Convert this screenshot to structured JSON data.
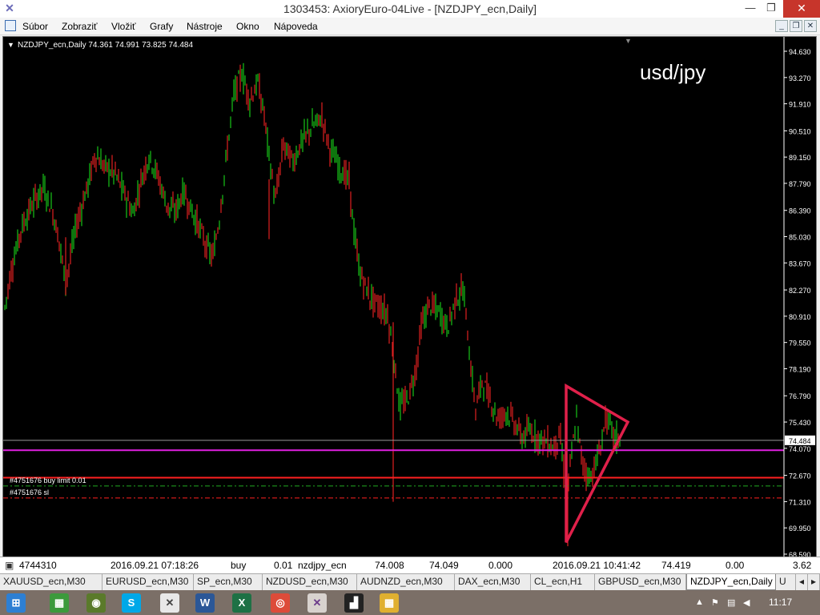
{
  "window": {
    "title": "1303453: AxioryEuro-04Live - [NZDJPY_ecn,Daily]",
    "minimize": "—",
    "maximize": "❐",
    "close": "✕"
  },
  "menu": [
    "Súbor",
    "Zobraziť",
    "Vložiť",
    "Grafy",
    "Nástroje",
    "Okno",
    "Nápoveda"
  ],
  "mdi": {
    "minimize": "_",
    "restore": "❐",
    "close": "✕"
  },
  "chart": {
    "header": "NZDJPY_ecn,Daily  74.361 74.991 73.825 74.484",
    "watermark": "usd/jpy",
    "current_price": "74.484",
    "orders": [
      "#4751676 buy limit 0.01",
      "#4751676 sl"
    ]
  },
  "chart_data": {
    "type": "candlestick",
    "symbol": "NZDJPY_ecn",
    "timeframe": "Daily",
    "ohlc_last": {
      "open": 74.361,
      "high": 74.991,
      "low": 73.825,
      "close": 74.484
    },
    "y_ticks": [
      "94.630",
      "93.270",
      "91.910",
      "90.510",
      "89.150",
      "87.790",
      "86.390",
      "85.030",
      "83.670",
      "82.270",
      "80.910",
      "79.550",
      "78.190",
      "76.790",
      "75.430",
      "74.070",
      "72.670",
      "71.310",
      "69.950",
      "68.590"
    ],
    "ylim": [
      68.59,
      94.63
    ],
    "bid_line": 74.484,
    "horizontal_lines": [
      {
        "price": 73.97,
        "color": "#e020e0",
        "style": "solid"
      },
      {
        "price": 72.55,
        "color": "#ff2020",
        "style": "solid"
      },
      {
        "price": 72.12,
        "color": "#22aa22",
        "style": "dashdot"
      },
      {
        "price": 71.5,
        "color": "#ff2020",
        "style": "dashdot"
      }
    ],
    "path": [
      [
        0,
        80.9
      ],
      [
        10,
        83.3
      ],
      [
        22,
        85.4
      ],
      [
        35,
        86.6
      ],
      [
        50,
        87.6
      ],
      [
        62,
        86.3
      ],
      [
        70,
        84.8
      ],
      [
        78,
        82.6
      ],
      [
        90,
        85.4
      ],
      [
        105,
        87.6
      ],
      [
        115,
        89.3
      ],
      [
        125,
        88.7
      ],
      [
        140,
        88.3
      ],
      [
        155,
        86.9
      ],
      [
        162,
        86.2
      ],
      [
        172,
        87.9
      ],
      [
        182,
        89.2
      ],
      [
        192,
        88.3
      ],
      [
        205,
        86.6
      ],
      [
        215,
        86.3
      ],
      [
        225,
        87.4
      ],
      [
        235,
        86.4
      ],
      [
        245,
        85.5
      ],
      [
        255,
        84.4
      ],
      [
        262,
        84.0
      ],
      [
        270,
        86.0
      ],
      [
        280,
        89.6
      ],
      [
        288,
        92.4
      ],
      [
        298,
        93.5
      ],
      [
        308,
        92.1
      ],
      [
        318,
        93.0
      ],
      [
        326,
        91.3
      ],
      [
        333,
        88.9
      ],
      [
        340,
        86.9
      ],
      [
        350,
        89.8
      ],
      [
        362,
        88.9
      ],
      [
        372,
        89.9
      ],
      [
        385,
        90.7
      ],
      [
        398,
        91.2
      ],
      [
        408,
        89.6
      ],
      [
        420,
        88.6
      ],
      [
        432,
        87.9
      ],
      [
        438,
        85.3
      ],
      [
        445,
        83.2
      ],
      [
        458,
        81.9
      ],
      [
        470,
        81.4
      ],
      [
        480,
        81.0
      ],
      [
        488,
        78.7
      ],
      [
        495,
        76.2
      ],
      [
        505,
        76.6
      ],
      [
        515,
        78.1
      ],
      [
        522,
        80.4
      ],
      [
        532,
        81.5
      ],
      [
        545,
        81.1
      ],
      [
        555,
        80.3
      ],
      [
        565,
        81.8
      ],
      [
        575,
        82.3
      ],
      [
        583,
        78.6
      ],
      [
        590,
        76.1
      ],
      [
        598,
        77.6
      ],
      [
        608,
        76.6
      ],
      [
        618,
        75.6
      ],
      [
        628,
        76.0
      ],
      [
        638,
        75.4
      ],
      [
        648,
        74.6
      ],
      [
        658,
        75.0
      ],
      [
        668,
        74.6
      ],
      [
        678,
        74.4
      ],
      [
        688,
        74.1
      ],
      [
        695,
        74.9
      ],
      [
        700,
        72.9
      ],
      [
        705,
        72.0
      ],
      [
        710,
        73.8
      ],
      [
        716,
        75.6
      ],
      [
        722,
        73.6
      ],
      [
        728,
        72.8
      ],
      [
        734,
        72.6
      ],
      [
        740,
        73.3
      ],
      [
        746,
        74.1
      ],
      [
        752,
        75.6
      ],
      [
        758,
        75.2
      ],
      [
        764,
        74.6
      ],
      [
        770,
        74.5
      ]
    ],
    "triangle": [
      [
        703,
        77.3
      ],
      [
        780,
        75.43
      ],
      [
        703,
        69.2
      ]
    ]
  },
  "trade_row": [
    "4744310",
    "2016.09.21 07:18:26",
    "buy",
    "0.01",
    "nzdjpy_ecn",
    "74.008",
    "74.049",
    "0.000",
    "2016.09.21 10:41:42",
    "74.419",
    "0.00",
    "3.62"
  ],
  "tabs": [
    "XAUUSD_ecn,M30",
    "EURUSD_ecn,M30",
    "SP_ecn,M30",
    "NZDUSD_ecn,M30",
    "AUDNZD_ecn,M30",
    "DAX_ecn,M30",
    "CL_ecn,H1",
    "GBPUSD_ecn,M30",
    "NZDJPY_ecn,Daily",
    "U"
  ],
  "active_tab": 8,
  "taskbar": {
    "clock": "11:17"
  },
  "colors": {
    "bull": "#18c418",
    "bear": "#e02020",
    "grid_axis": "#ffffff",
    "triangle": "#e0204a"
  }
}
